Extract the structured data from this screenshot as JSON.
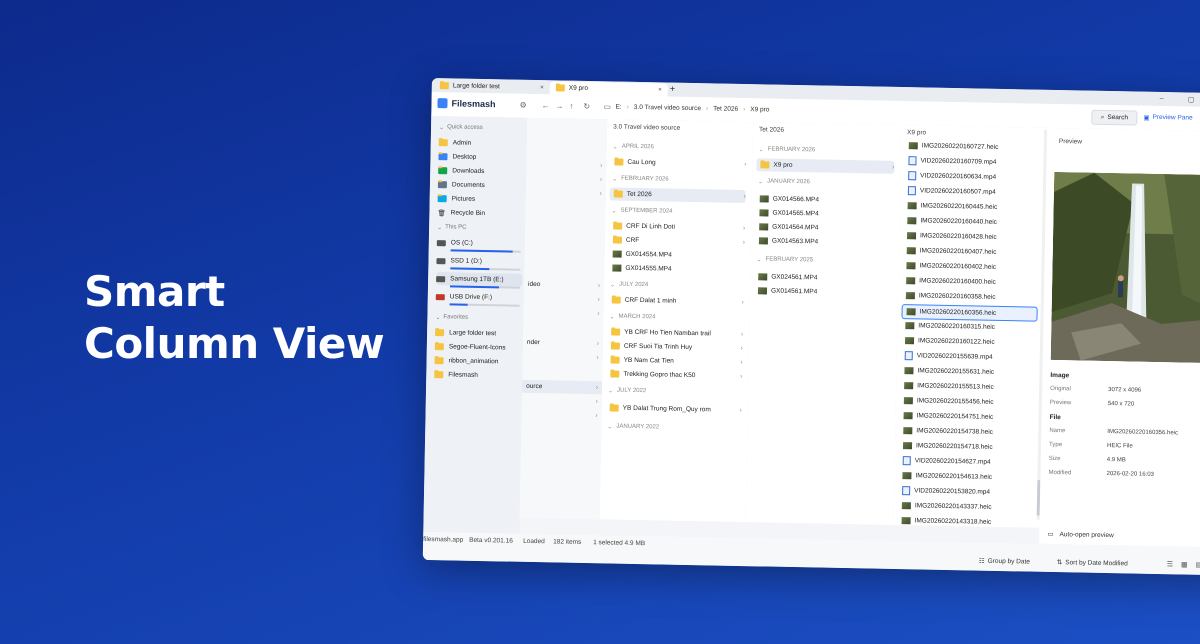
{
  "headline": {
    "line1": "Smart",
    "line2": "Column View"
  },
  "tabs": [
    {
      "label": "Large folder test",
      "close": "×"
    },
    {
      "label": "X9 pro",
      "close": "×"
    }
  ],
  "new_tab": "+",
  "window_controls": {
    "minimize": "–",
    "maximize": "▢",
    "close": "✕"
  },
  "toolbar": {
    "app_name": "Filesmash",
    "breadcrumbs": [
      "E:",
      "3.0 Travel video source",
      "Tet 2026",
      "X9 pro"
    ],
    "search_label": "Search",
    "preview_pane_label": "Preview Pane"
  },
  "sidebar": {
    "quick_access_label": "Quick access",
    "quick_access": [
      "Admin",
      "Desktop",
      "Downloads",
      "Documents",
      "Pictures",
      "Recycle Bin"
    ],
    "this_pc_label": "This PC",
    "drives": [
      {
        "label": "OS (C:)",
        "usage": 0.88
      },
      {
        "label": "SSD 1 (D:)",
        "usage": 0.55
      },
      {
        "label": "Samsung 1TB (E:)",
        "usage": 0.7
      },
      {
        "label": "USB Drive (F:)",
        "usage": 0.25
      }
    ],
    "favorites_label": "Favorites",
    "favorites": [
      "Large folder test",
      "Segoe-Fluent-Icons",
      "ribbon_animation",
      "Filesmash"
    ]
  },
  "col0": {
    "items": [
      "ideo",
      "nder",
      "ource"
    ]
  },
  "col1": {
    "header": "3.0 Travel video source",
    "groups": {
      "g1": "APRIL 2026",
      "g2": "FEBRUARY 2026",
      "g3": "SEPTEMBER 2024",
      "g4": "JULY 2024",
      "g5": "MARCH 2024",
      "g6": "JULY 2022",
      "g7": "JANUARY 2022"
    },
    "items": {
      "cau_long": "Cau Long",
      "tet_2026": "Tet 2026",
      "crf_di_linh": "CRF Di Linh Doti",
      "crf": "CRF",
      "gx014554": "GX014554.MP4",
      "gx014555": "GX014555.MP4",
      "crf_dalat": "CRF Dalat 1 minh",
      "yb_crf": "YB CRF Ho Tien Namban trail",
      "crf_suoi": "CRF Suoi Tia Trinh Huy",
      "yb_nam": "YB Nam Cat Tien",
      "trekking": "Trekking Gopro thac K50",
      "yb_dalat": "YB Dalat Trung Rom_Quy rom"
    }
  },
  "col2": {
    "header": "Tet 2026",
    "groups": {
      "g1": "FEBRUARY 2026",
      "g2": "JANUARY 2026",
      "g3": "FEBRUARY 2025"
    },
    "items": {
      "x9pro": "X9 pro",
      "gx014566": "GX014566.MP4",
      "gx014565": "GX014565.MP4",
      "gx014564": "GX014564.MP4",
      "gx014563": "GX014563.MP4",
      "gx024561": "GX024561.MP4",
      "gx014561": "GX014561.MP4"
    }
  },
  "col3": {
    "header": "X9 pro",
    "files": [
      {
        "name": "IMG20260220160727.heic",
        "type": "img"
      },
      {
        "name": "VID20260220160709.mp4",
        "type": "vid"
      },
      {
        "name": "VID20260220160634.mp4",
        "type": "vid"
      },
      {
        "name": "VID20260220160507.mp4",
        "type": "vid"
      },
      {
        "name": "IMG20260220160445.heic",
        "type": "img"
      },
      {
        "name": "IMG20260220160440.heic",
        "type": "img"
      },
      {
        "name": "IMG20260220160428.heic",
        "type": "img"
      },
      {
        "name": "IMG20260220160407.heic",
        "type": "img"
      },
      {
        "name": "IMG20260220160402.heic",
        "type": "img"
      },
      {
        "name": "IMG20260220160400.heic",
        "type": "img"
      },
      {
        "name": "IMG20260220160358.heic",
        "type": "img"
      },
      {
        "name": "IMG20260220160356.heic",
        "type": "img"
      },
      {
        "name": "IMG20260220160315.heic",
        "type": "img"
      },
      {
        "name": "IMG20260220160122.heic",
        "type": "img"
      },
      {
        "name": "VID20260220155639.mp4",
        "type": "vid"
      },
      {
        "name": "IMG20260220155631.heic",
        "type": "img"
      },
      {
        "name": "IMG20260220155513.heic",
        "type": "img"
      },
      {
        "name": "IMG20260220155456.heic",
        "type": "img"
      },
      {
        "name": "IMG20260220154751.heic",
        "type": "img"
      },
      {
        "name": "IMG20260220154738.heic",
        "type": "img"
      },
      {
        "name": "IMG20260220154718.heic",
        "type": "img"
      },
      {
        "name": "VID20260220154627.mp4",
        "type": "vid"
      },
      {
        "name": "IMG20260220154613.heic",
        "type": "img"
      },
      {
        "name": "VID20260220153820.mp4",
        "type": "vid"
      },
      {
        "name": "IMG20260220143337.heic",
        "type": "img"
      },
      {
        "name": "IMG20260220143318.heic",
        "type": "img"
      }
    ]
  },
  "preview": {
    "title": "Preview",
    "image_section": "Image",
    "original_label": "Original",
    "original_value": "3072 x 4096",
    "preview_label": "Preview",
    "preview_value": "540 x 720",
    "file_section": "File",
    "name_label": "Name",
    "name_value": "IMG20260220160356.heic",
    "type_label": "Type",
    "type_value": "HEIC File",
    "size_label": "Size",
    "size_value": "4.9 MB",
    "modified_label": "Modified",
    "modified_value": "2026-02-20 16:03",
    "auto_open": "Auto-open preview"
  },
  "status": {
    "site": "filesmash.app",
    "version": "Beta v0.201.16",
    "loaded": "Loaded",
    "items": "182 items",
    "selected": "1 selected 4.9 MB",
    "group_by": "Group by Date",
    "sort_by": "Sort by Date Modified"
  },
  "colors": {
    "accent": "#2563eb",
    "folder": "#f5c542",
    "background": "#123ba8"
  }
}
